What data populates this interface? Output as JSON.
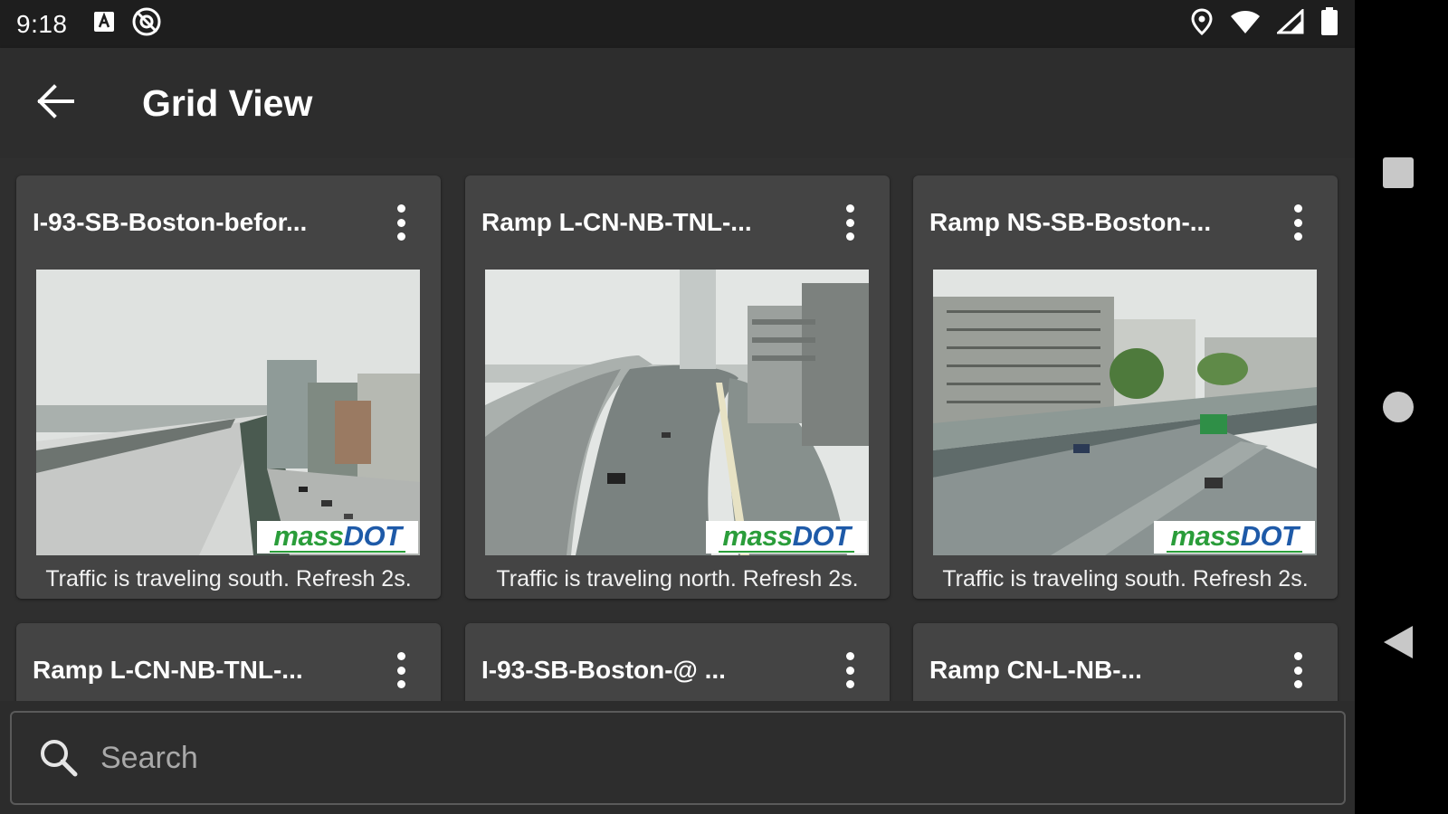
{
  "status_bar": {
    "time": "9:18",
    "left_icons": [
      "font-a-icon",
      "no-sync-icon"
    ],
    "right_icons": [
      "location-pin-icon",
      "wifi-icon",
      "cell-signal-icon",
      "battery-icon"
    ]
  },
  "app_bar": {
    "title": "Grid View",
    "back_icon": "arrow-back-icon"
  },
  "cards": [
    {
      "title": "I-93-SB-Boston-befor...",
      "caption": "Traffic is traveling south. Refresh 2s.",
      "logo_mass": "mass",
      "logo_dot": "DOT"
    },
    {
      "title": "Ramp L-CN-NB-TNL-...",
      "caption": "Traffic is traveling north. Refresh 2s.",
      "logo_mass": "mass",
      "logo_dot": "DOT"
    },
    {
      "title": "Ramp NS-SB-Boston-...",
      "caption": "Traffic is traveling south. Refresh 2s.",
      "logo_mass": "mass",
      "logo_dot": "DOT"
    },
    {
      "title": "Ramp L-CN-NB-TNL-..."
    },
    {
      "title": "I-93-SB-Boston-@ ..."
    },
    {
      "title": "Ramp CN-L-NB-..."
    }
  ],
  "search": {
    "placeholder": "Search",
    "value": ""
  },
  "colors": {
    "background": "#2f2f2f",
    "card": "#444444",
    "status_bar": "#1e1e1e",
    "massdot_green": "#2a9d3a",
    "massdot_blue": "#1e5aa8"
  }
}
